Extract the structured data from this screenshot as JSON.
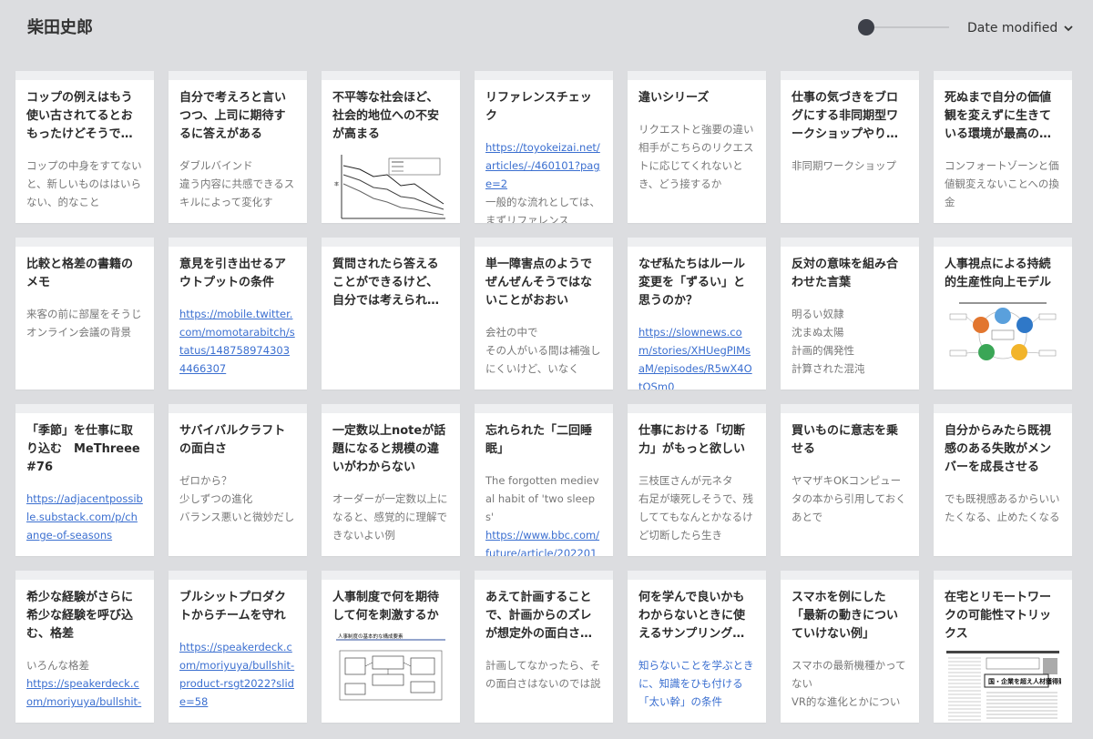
{
  "header": {
    "title": "柴田史郎",
    "sort_label": "Date modified"
  },
  "cards": [
    {
      "title": "コップの例えはもう使い古されてるとおもったけどそうで…",
      "lines": [
        {
          "t": "コップの中身をすてないと、新しいものははいらない、的なこと",
          "k": "text"
        }
      ]
    },
    {
      "title": "自分で考えろと言いつつ、上司に期待するに答えがある",
      "lines": [
        {
          "t": "ダブルバインド",
          "k": "text"
        },
        {
          "t": "違う内容に共感できるスキルによって変化す",
          "k": "text"
        }
      ]
    },
    {
      "title": "不平等な社会ほど、社会的地位への不安が高まる",
      "thumb": "line-chart",
      "lines": []
    },
    {
      "title": "リファレンスチェック",
      "lines": [
        {
          "t": "https://toyokeizai.net/articles/-/460101?page=2",
          "k": "link"
        },
        {
          "t": "一般的な流れとしては、まずリファレンス",
          "k": "text"
        }
      ]
    },
    {
      "title": "違いシリーズ",
      "lines": [
        {
          "t": "リクエストと強要の違い",
          "k": "text"
        },
        {
          "t": "相手がこちらのリクエストに応じてくれないとき、どう接するか",
          "k": "text"
        }
      ]
    },
    {
      "title": "仕事の気づきをブログにする非同期型ワークショップやり…",
      "lines": [
        {
          "t": "非同期ワークショップ",
          "k": "text"
        }
      ]
    },
    {
      "title": "死ぬまで自分の価値観を変えずに生きている環境が最高の…",
      "lines": [
        {
          "t": "コンフォートゾーンと価値観変えないことへの換金",
          "k": "text"
        }
      ]
    },
    {
      "title": "比較と格差の書籍のメモ",
      "lines": [
        {
          "t": "来客の前に部屋をそうじ",
          "k": "text"
        },
        {
          "t": "オンライン会議の背景",
          "k": "text"
        }
      ]
    },
    {
      "title": "意見を引き出せるアウトプットの条件",
      "lines": [
        {
          "t": "https://mobile.twitter.com/momotarabitch/status/1487589743034466307",
          "k": "link"
        }
      ]
    },
    {
      "title": "質問されたら答えることができるけど、自分では考えられ…",
      "lines": []
    },
    {
      "title": "単一障害点のようでぜんぜんそうではないことがおおい",
      "lines": [
        {
          "t": "会社の中で",
          "k": "text"
        },
        {
          "t": "その人がいる間は補強しにくいけど、いなく",
          "k": "text"
        }
      ]
    },
    {
      "title": "なぜ私たちはルール変更を「ずるい」と思うのか？",
      "lines": [
        {
          "t": "https://slownews.com/stories/XHUegPIMsaM/episodes/R5wX4OtOSm0",
          "k": "link"
        }
      ]
    },
    {
      "title": "反対の意味を組み合わせた言葉",
      "lines": [
        {
          "t": "明るい奴隷",
          "k": "text"
        },
        {
          "t": "沈まぬ太陽",
          "k": "text"
        },
        {
          "t": "計画的偶発性",
          "k": "text"
        },
        {
          "t": "計算された混沌",
          "k": "text"
        }
      ]
    },
    {
      "title": "人事視点による持続的生産性向上モデル",
      "thumb": "cycle-diagram",
      "lines": []
    },
    {
      "title": "「季節」を仕事に取り込む　MeThreee #76",
      "lines": [
        {
          "t": "https://adjacentpossible.substack.com/p/change-of-seasons",
          "k": "link"
        }
      ]
    },
    {
      "title": "サバイバルクラフトの面白さ",
      "lines": [
        {
          "t": "ゼロから？",
          "k": "text"
        },
        {
          "t": "少しずつの進化",
          "k": "text"
        },
        {
          "t": "バランス悪いと微妙だし",
          "k": "text"
        }
      ]
    },
    {
      "title": "一定数以上noteが話題になると規模の違いがわからない",
      "lines": [
        {
          "t": "オーダーが一定数以上になると、感覚的に理解できないよい例",
          "k": "text"
        }
      ]
    },
    {
      "title": "忘れられた「二回睡眠」",
      "lines": [
        {
          "t": "The forgotten medieval habit of 'two sleeps'",
          "k": "text"
        },
        {
          "t": "https://www.bbc.com/future/article/20220107-",
          "k": "link"
        }
      ]
    },
    {
      "title": "仕事における「切断力」がもっと欲しい",
      "lines": [
        {
          "t": "三枝匡さんが元ネタ",
          "k": "text"
        },
        {
          "t": "右足が壊死しそうで、残しててもなんとかなるけど切断したら生き",
          "k": "text"
        }
      ]
    },
    {
      "title": "買いものに意志を乗せる",
      "lines": [
        {
          "t": "ヤマザキOKコンピュータの本から引用しておくあとで",
          "k": "text"
        }
      ]
    },
    {
      "title": "自分からみたら既視感のある失敗がメンバーを成長させる",
      "lines": [
        {
          "t": "でも既視感あるからいいたくなる、止めたくなる",
          "k": "text"
        }
      ]
    },
    {
      "title": "希少な経験がさらに希少な経験を呼び込む、格差",
      "lines": [
        {
          "t": "いろんな格差",
          "k": "text"
        },
        {
          "t": "https://speakerdeck.com/moriyuya/bullshit-",
          "k": "link"
        }
      ]
    },
    {
      "title": "ブルシットプロダクトからチームを守れ",
      "lines": [
        {
          "t": "https://speakerdeck.com/moriyuya/bullshit-product-rsgt2022?slide=58",
          "k": "link"
        }
      ]
    },
    {
      "title": "人事制度で何を期待して何を刺激するか",
      "thumb": "system-diagram",
      "thumb_caption": "人事制度の基本的な構成要素",
      "lines": []
    },
    {
      "title": "あえて計画することで、計画からのズレが想定外の面白さ…",
      "lines": [
        {
          "t": "計画してなかったら、その面白さはないのでは説",
          "k": "text"
        }
      ]
    },
    {
      "title": "何を学んで良いかもわからないときに使えるサンプリング…",
      "lines": [
        {
          "t": "知らないことを学ぶときに、知識をひも付ける「太い幹」の条件",
          "k": "blue"
        }
      ]
    },
    {
      "title": "スマホを例にした「最新の動きについていけない例」",
      "lines": [
        {
          "t": "スマホの最新機種かってない",
          "k": "text"
        },
        {
          "t": "VR的な進化とかについ",
          "k": "text"
        }
      ]
    },
    {
      "title": "在宅とリモートワークの可能性マトリックス",
      "thumb": "newspaper",
      "thumb_caption": "国・企業を超え人材獲得競う",
      "lines": []
    }
  ]
}
